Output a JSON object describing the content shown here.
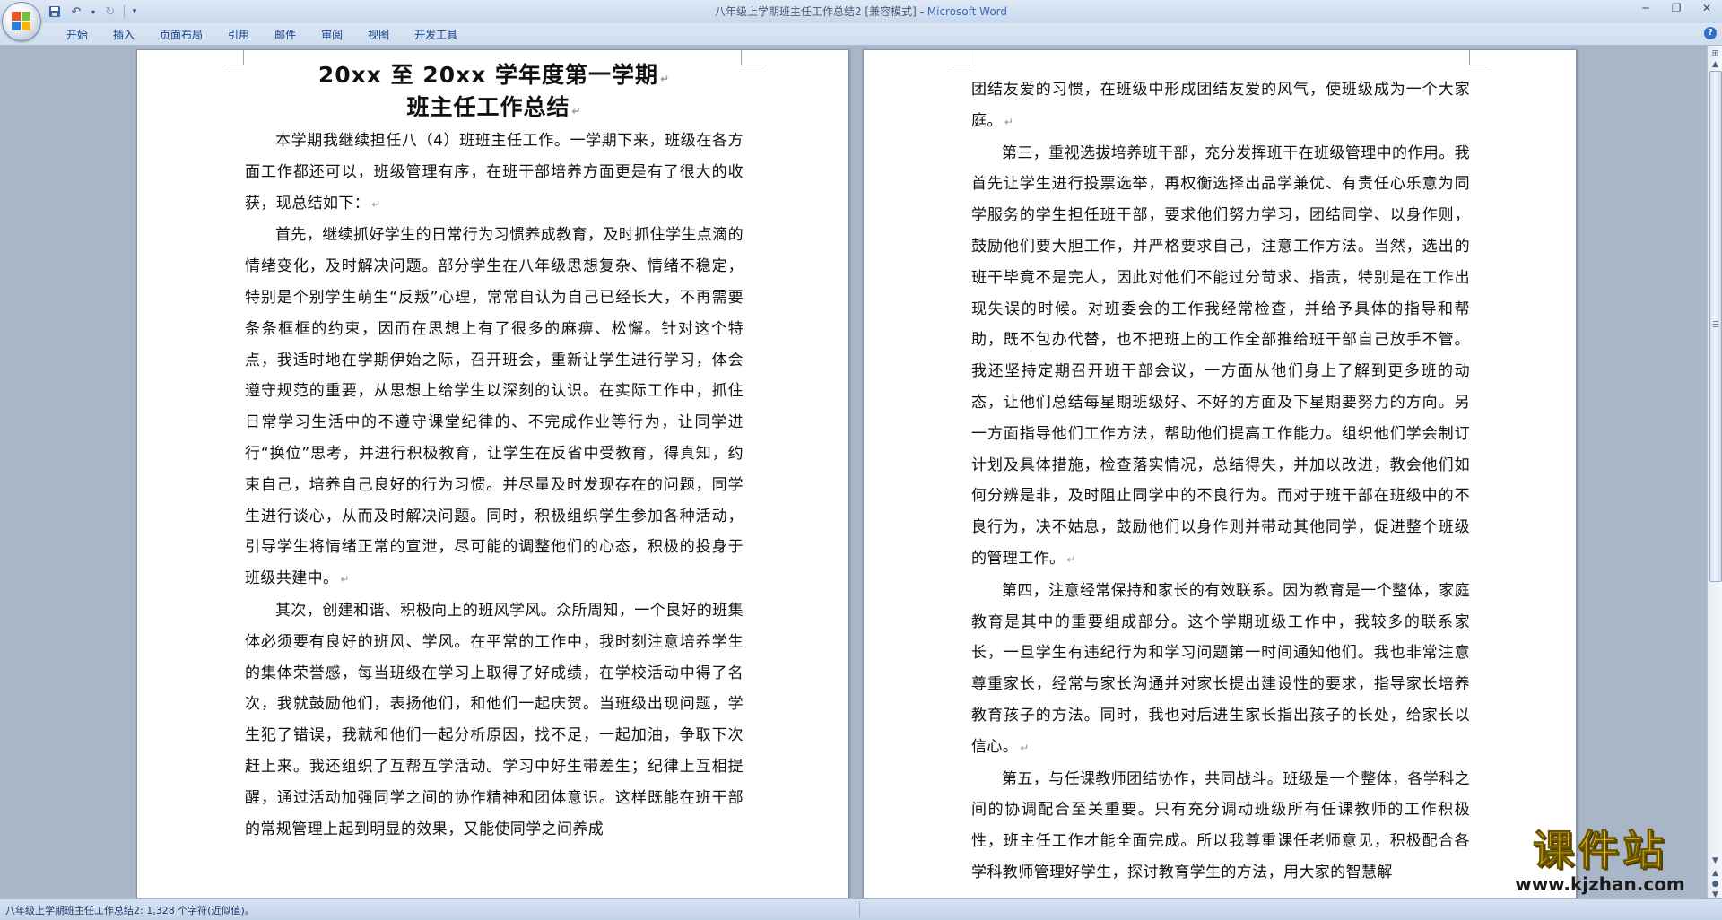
{
  "window": {
    "title": "八年级上学期班主任工作总结2 [兼容模式] - ",
    "app_name": "Microsoft Word"
  },
  "quick_access": [
    "save-icon",
    "undo-icon",
    "redo-icon",
    "customize-icon"
  ],
  "ribbon": {
    "tabs": [
      "开始",
      "插入",
      "页面布局",
      "引用",
      "邮件",
      "审阅",
      "视图",
      "开发工具"
    ]
  },
  "document": {
    "title_line1": "20xx 至 20xx 学年度第一学期",
    "title_line2": "班主任工作总结",
    "left_paragraphs": [
      "本学期我继续担任八（4）班班主任工作。一学期下来，班级在各方面工作都还可以，班级管理有序，在班干部培养方面更是有了很大的收获，现总结如下：",
      "首先，继续抓好学生的日常行为习惯养成教育，及时抓住学生点滴的情绪变化，及时解决问题。部分学生在八年级思想复杂、情绪不稳定，特别是个别学生萌生“反叛”心理，常常自认为自己已经长大，不再需要条条框框的约束，因而在思想上有了很多的麻痹、松懈。针对这个特点，我适时地在学期伊始之际，召开班会，重新让学生进行学习，体会遵守规范的重要，从思想上给学生以深刻的认识。在实际工作中，抓住日常学习生活中的不遵守课堂纪律的、不完成作业等行为，让同学进行“换位”思考，并进行积极教育，让学生在反省中受教育，得真知，约束自己，培养自己良好的行为习惯。并尽量及时发现存在的问题，同学生进行谈心，从而及时解决问题。同时，积极组织学生参加各种活动，引导学生将情绪正常的宣泄，尽可能的调整他们的心态，积极的投身于班级共建中。",
      "其次，创建和谐、积极向上的班风学风。众所周知，一个良好的班集体必须要有良好的班风、学风。在平常的工作中，我时刻注意培养学生的集体荣誉感，每当班级在学习上取得了好成绩，在学校活动中得了名次，我就鼓励他们，表扬他们，和他们一起庆贺。当班级出现问题，学生犯了错误，我就和他们一起分析原因，找不足，一起加油，争取下次赶上来。我还组织了互帮互学活动。学习中好生带差生；纪律上互相提醒，通过活动加强同学之间的协作精神和团体意识。这样既能在班干部的常规管理上起到明显的效果，又能使同学之间养成"
    ],
    "right_paragraphs": [
      "团结友爱的习惯，在班级中形成团结友爱的风气，使班级成为一个大家庭。",
      "第三，重视选拔培养班干部，充分发挥班干在班级管理中的作用。我首先让学生进行投票选举，再权衡选择出品学兼优、有责任心乐意为同学服务的学生担任班干部，要求他们努力学习，团结同学、以身作则，鼓励他们要大胆工作，并严格要求自己，注意工作方法。当然，选出的班干毕竟不是完人，因此对他们不能过分苛求、指责，特别是在工作出现失误的时候。对班委会的工作我经常检查，并给予具体的指导和帮助，既不包办代替，也不把班上的工作全部推给班干部自己放手不管。我还坚持定期召开班干部会议，一方面从他们身上了解到更多班的动态，让他们总结每星期班级好、不好的方面及下星期要努力的方向。另一方面指导他们工作方法，帮助他们提高工作能力。组织他们学会制订计划及具体措施，检查落实情况，总结得失，并加以改进，教会他们如何分辨是非，及时阻止同学中的不良行为。而对于班干部在班级中的不良行为，决不姑息，鼓励他们以身作则并带动其他同学，促进整个班级的管理工作。",
      "第四，注意经常保持和家长的有效联系。因为教育是一个整体，家庭教育是其中的重要组成部分。这个学期班级工作中，我较多的联系家长，一旦学生有违纪行为和学习问题第一时间通知他们。我也非常注意尊重家长，经常与家长沟通并对家长提出建设性的要求，指导家长培养教育孩子的方法。同时，我也对后进生家长指出孩子的长处，给家长以信心。",
      "第五，与任课教师团结协作，共同战斗。班级是一个整体，各学科之间的协调配合至关重要。只有充分调动班级所有任课教师的工作积极性，班主任工作才能全面完成。所以我尊重课任老师意见，积极配合各学科教师管理好学生，探讨教育学生的方法，用大家的智慧解"
    ]
  },
  "status_bar": {
    "text": "八年级上学期班主任工作总结2: 1,328 个字符(近似值)。"
  },
  "watermark": {
    "title": "课件站",
    "url": "www.kjzhan.com"
  },
  "colors": {
    "brand": "#3b6ab8",
    "tab_text": "#15428b",
    "workspace": "#a8b6c8",
    "watermark": "#f0c010"
  }
}
